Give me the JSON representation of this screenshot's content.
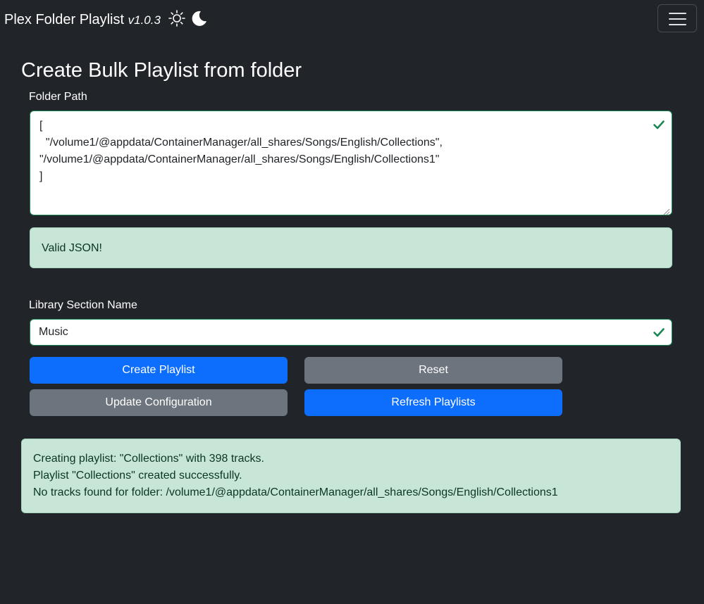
{
  "app": {
    "name": "Plex Folder Playlist",
    "version": "v1.0.3",
    "sun_icon": "sun-icon",
    "moon_icon": "moon-icon",
    "menu_icon": "hamburger-icon"
  },
  "page": {
    "title": "Create Bulk Playlist from folder"
  },
  "folder_path": {
    "label": "Folder Path",
    "value": "[\n  \"/volume1/@appdata/ContainerManager/all_shares/Songs/English/Collections\",\n\"/volume1/@appdata/ContainerManager/all_shares/Songs/English/Collections1\"\n]",
    "valid": true
  },
  "validation": {
    "message": "Valid JSON!"
  },
  "library_section": {
    "label": "Library Section Name",
    "value": "Music",
    "valid": true
  },
  "buttons": {
    "create": "Create Playlist",
    "reset": "Reset",
    "update": "Update Configuration",
    "refresh": "Refresh Playlists"
  },
  "log": {
    "lines": [
      "Creating playlist: \"Collections\" with 398 tracks.",
      "Playlist \"Collections\" created successfully.",
      "No tracks found for folder: /volume1/@appdata/ContainerManager/all_shares/Songs/English/Collections1"
    ]
  },
  "colors": {
    "background": "#212529",
    "primary": "#0d6efd",
    "secondary": "#6c757d",
    "success": "#198754",
    "success_bg": "#c8e6d8"
  }
}
